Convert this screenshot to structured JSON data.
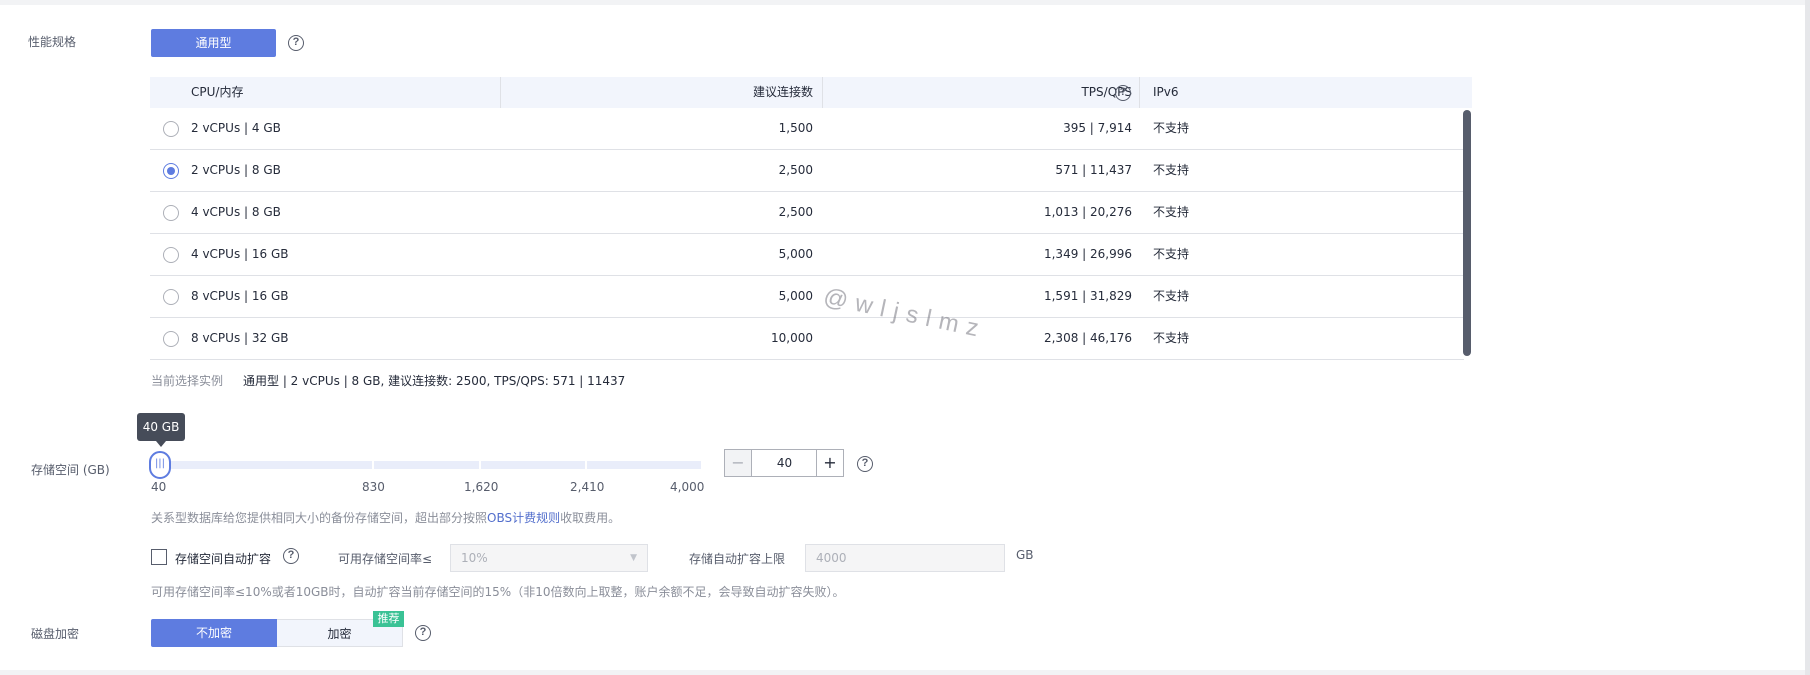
{
  "spec": {
    "label": "性能规格",
    "type_button": "通用型",
    "help": "?"
  },
  "table": {
    "headers": [
      "CPU/内存",
      "建议连接数",
      "TPS/QPS",
      "IPv6"
    ],
    "rows": [
      {
        "cpu": "2 vCPUs | 4 GB",
        "conn": "1,500",
        "tps": "395 | 7,914",
        "ipv6": "不支持",
        "selected": false
      },
      {
        "cpu": "2 vCPUs | 8 GB",
        "conn": "2,500",
        "tps": "571 | 11,437",
        "ipv6": "不支持",
        "selected": true
      },
      {
        "cpu": "4 vCPUs | 8 GB",
        "conn": "2,500",
        "tps": "1,013 | 20,276",
        "ipv6": "不支持",
        "selected": false
      },
      {
        "cpu": "4 vCPUs | 16 GB",
        "conn": "5,000",
        "tps": "1,349 | 26,996",
        "ipv6": "不支持",
        "selected": false
      },
      {
        "cpu": "8 vCPUs | 16 GB",
        "conn": "5,000",
        "tps": "1,591 | 31,829",
        "ipv6": "不支持",
        "selected": false
      },
      {
        "cpu": "8 vCPUs | 32 GB",
        "conn": "10,000",
        "tps": "2,308 | 46,176",
        "ipv6": "不支持",
        "selected": false
      }
    ]
  },
  "current": {
    "label": "当前选择实例",
    "value": "通用型 | 2 vCPUs | 8 GB, 建议连接数: 2500, TPS/QPS: 571 | 11437"
  },
  "storage": {
    "label": "存储空间 (GB)",
    "tooltip": "40 GB",
    "ticks": [
      "40",
      "830",
      "1,620",
      "2,410",
      "4,000"
    ],
    "value": "40",
    "minus": "−",
    "plus": "+",
    "note_prefix": "关系型数据库给您提供相同大小的备份存储空间，超出部分按照",
    "note_link": "OBS计费规则",
    "note_suffix": "收取费用。",
    "slider_level": 0.0
  },
  "autoscale": {
    "checkbox_label": "存储空间自动扩容",
    "rate_label": "可用存储空间率≤",
    "rate_value": "10%",
    "limit_label": "存储自动扩容上限",
    "limit_placeholder": "4000",
    "unit": "GB",
    "hint": "可用存储空间率≤10%或者10GB时，自动扩容当前存储空间的15%（非10倍数向上取整，账户余额不足，会导致自动扩容失败）。"
  },
  "encryption": {
    "label": "磁盘加密",
    "off": "不加密",
    "on": "加密",
    "badge": "推荐"
  },
  "watermark": "@wljslmz",
  "colors": {
    "accent": "#5e7ce0",
    "badge": "#3ac295"
  }
}
